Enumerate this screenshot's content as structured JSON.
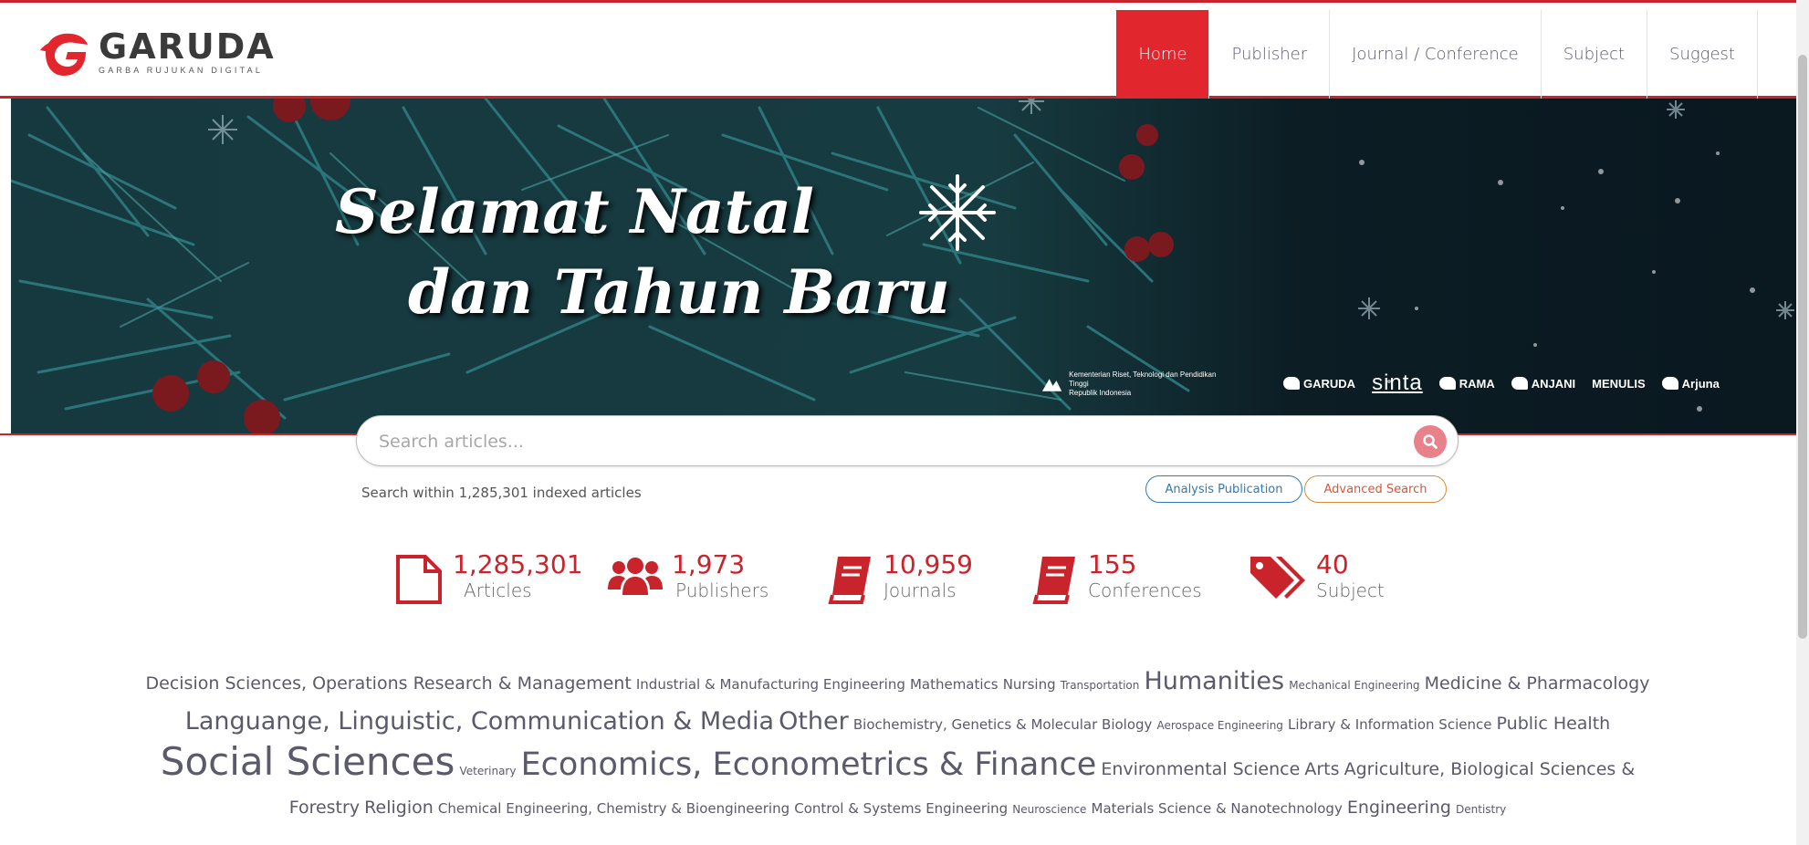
{
  "brand": {
    "name": "GARUDA",
    "tagline": "GARBA RUJUKAN DIGITAL",
    "accent_color": "#e2262d"
  },
  "nav": {
    "items": [
      {
        "label": "Home",
        "active": true
      },
      {
        "label": "Publisher",
        "active": false
      },
      {
        "label": "Journal / Conference",
        "active": false
      },
      {
        "label": "Subject",
        "active": false
      },
      {
        "label": "Suggest",
        "active": false
      }
    ]
  },
  "banner": {
    "title_line1": "Selamat Natal",
    "title_line2": "dan Tahun Baru",
    "ministry_line1": "Kementerian Riset, Teknologi dan Pendidikan Tinggi",
    "ministry_line2": "Republik Indonesia",
    "partners": [
      "GARUDA",
      "sinta",
      "RAMA",
      "ANJANI",
      "MENULIS",
      "Arjuna"
    ]
  },
  "search": {
    "placeholder": "Search articles...",
    "indexed_text": "Search within 1,285,301 indexed articles",
    "analysis_label": "Analysis Publication",
    "advanced_label": "Advanced Search"
  },
  "stats": [
    {
      "value": "1,285,301",
      "label": "Articles",
      "icon": "document-icon"
    },
    {
      "value": "1,973",
      "label": "Publishers",
      "icon": "users-icon"
    },
    {
      "value": "10,959",
      "label": "Journals",
      "icon": "book-icon"
    },
    {
      "value": "155",
      "label": "Conferences",
      "icon": "book-icon"
    },
    {
      "value": "40",
      "label": "Subject",
      "icon": "tags-icon"
    }
  ],
  "subjects": [
    {
      "label": "Decision Sciences, Operations Research & Management",
      "size": 3
    },
    {
      "label": "Industrial & Manufacturing Engineering",
      "size": 2
    },
    {
      "label": "Mathematics",
      "size": 2
    },
    {
      "label": "Nursing",
      "size": 2
    },
    {
      "label": "Transportation",
      "size": 1
    },
    {
      "label": "Humanities",
      "size": 4
    },
    {
      "label": "Mechanical Engineering",
      "size": 1
    },
    {
      "label": "Medicine & Pharmacology",
      "size": 3
    },
    {
      "label": "Languange, Linguistic, Communication & Media",
      "size": 4
    },
    {
      "label": "Other",
      "size": 4
    },
    {
      "label": "Biochemistry, Genetics & Molecular Biology",
      "size": 2
    },
    {
      "label": "Aerospace Engineering",
      "size": 1
    },
    {
      "label": "Library & Information Science",
      "size": 2
    },
    {
      "label": "Public Health",
      "size": 3
    },
    {
      "label": "Social Sciences",
      "size": 6
    },
    {
      "label": "Veterinary",
      "size": 1
    },
    {
      "label": "Economics, Econometrics & Finance",
      "size": 5
    },
    {
      "label": "Environmental Science",
      "size": 3
    },
    {
      "label": "Arts",
      "size": 3
    },
    {
      "label": "Agriculture, Biological Sciences & Forestry",
      "size": 3
    },
    {
      "label": "Religion",
      "size": 3
    },
    {
      "label": "Chemical Engineering, Chemistry & Bioengineering",
      "size": 2
    },
    {
      "label": "Control & Systems Engineering",
      "size": 2
    },
    {
      "label": "Neuroscience",
      "size": 1
    },
    {
      "label": "Materials Science & Nanotechnology",
      "size": 2
    },
    {
      "label": "Engineering",
      "size": 3
    },
    {
      "label": "Dentistry",
      "size": 1
    }
  ]
}
